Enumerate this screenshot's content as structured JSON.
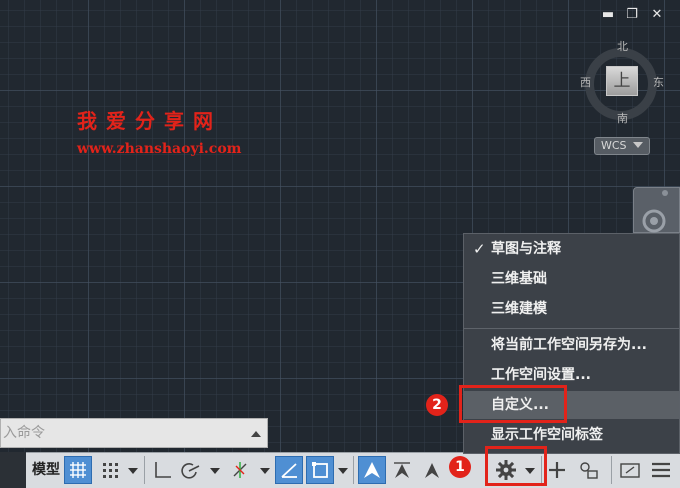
{
  "window": {
    "minimize_label": "▬",
    "restore_label": "❐",
    "close_label": "✕"
  },
  "viewcube": {
    "north": "北",
    "south": "南",
    "east": "东",
    "west": "西",
    "face": "上",
    "wcs_label": "WCS"
  },
  "watermark": {
    "title": "我爱分享网",
    "url": "www.zhanshaoyi.com",
    "color": "#e2231a"
  },
  "command_line": {
    "placeholder": "键入命令"
  },
  "statusbar": {
    "model_label": "模型",
    "buttons": [
      "grid-icon",
      "snap-icon",
      "ortho-icon",
      "polar-icon",
      "osnap-icon",
      "otrack-icon",
      "dynucs-icon",
      "selection-cycle-icon",
      "annotation-scale-icon",
      "annotation-visibility-icon",
      "autoscale-icon",
      "workspace-gear-icon",
      "plus-icon",
      "isolate-icon",
      "fullscreen-icon",
      "menu-icon"
    ],
    "accent": "#4f8fd3"
  },
  "workspace_menu": {
    "items": [
      {
        "label": "草图与注释",
        "checked": true
      },
      {
        "label": "三维基础"
      },
      {
        "label": "三维建模"
      },
      {
        "label": "将当前工作空间另存为..."
      },
      {
        "label": "工作空间设置..."
      },
      {
        "label": "自定义..."
      },
      {
        "label": "显示工作空间标签"
      }
    ],
    "check_mark": "✓"
  },
  "annotations": {
    "step1": "1",
    "step2": "2",
    "color": "#e2231a"
  }
}
